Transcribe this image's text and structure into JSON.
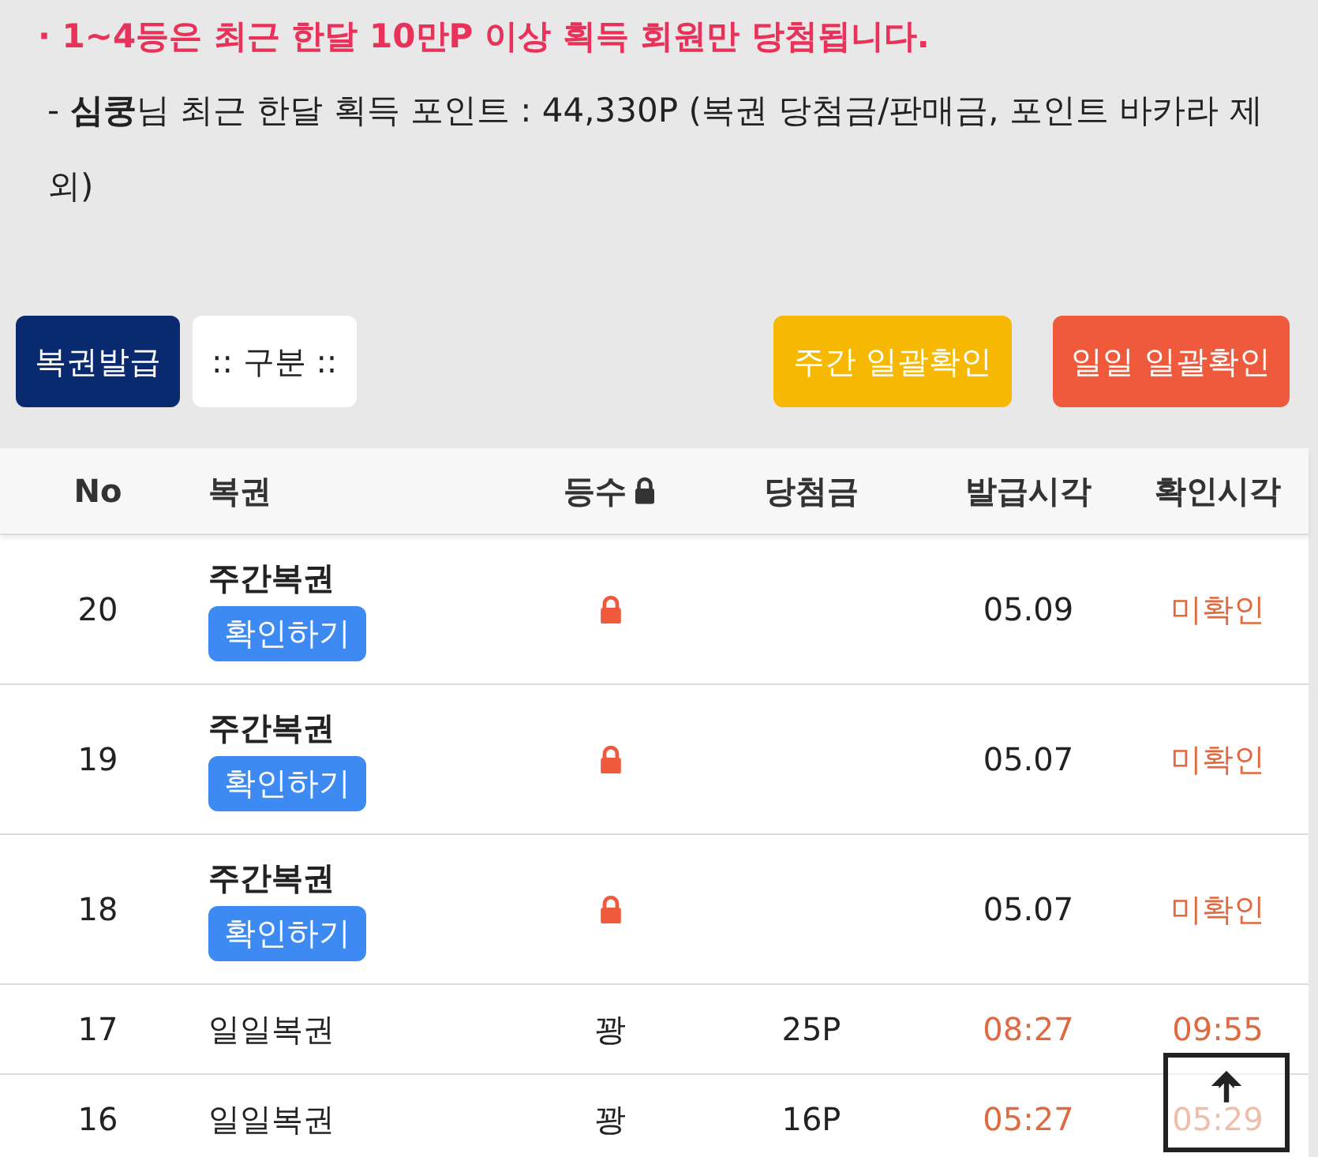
{
  "notice": {
    "bullet": "·",
    "text": "1~4등은 최근 한달 10만P 이상 획득 회원만 당첨됩니다.",
    "detail": "- **심쿵**님 최근 한달 획득 포인트 : 44,330P (복권 당첨금/판매금, 포인트 바카라 제외)"
  },
  "toolbar": {
    "left": [
      {
        "label": "복권발급",
        "kind": "primary"
      },
      {
        "label": ":: 구분 ::",
        "kind": "select"
      }
    ],
    "right": [
      {
        "label": "주간 일괄확인",
        "kind": "weekly"
      },
      {
        "label": "일일 일괄확인",
        "kind": "daily"
      }
    ]
  },
  "table": {
    "columns": [
      {
        "label": "No",
        "locked": false
      },
      {
        "label": "복권",
        "locked": false
      },
      {
        "label": "등수",
        "locked": true
      },
      {
        "label": "당첨금",
        "locked": false
      },
      {
        "label": "발급시각",
        "locked": false
      },
      {
        "label": "확인시각",
        "locked": false
      }
    ],
    "rows": [
      {
        "kind": "weekly",
        "no": "20",
        "name": "주간복권",
        "action": "확인하기",
        "locked": true,
        "issued": "05.09",
        "checked": "미확인"
      },
      {
        "kind": "weekly",
        "no": "19",
        "name": "주간복권",
        "action": "확인하기",
        "locked": true,
        "issued": "05.07",
        "checked": "미확인"
      },
      {
        "kind": "weekly",
        "no": "18",
        "name": "주간복권",
        "action": "확인하기",
        "locked": true,
        "issued": "05.07",
        "checked": "미확인"
      },
      {
        "kind": "daily",
        "no": "17",
        "name": "일일복권",
        "rank": "꽝",
        "prize": "25P",
        "issued": "08:27",
        "checked": "09:55"
      },
      {
        "kind": "daily",
        "no": "16",
        "name": "일일복권",
        "rank": "꽝",
        "prize": "16P",
        "issued": "05:27",
        "checked": "05:29"
      }
    ]
  }
}
